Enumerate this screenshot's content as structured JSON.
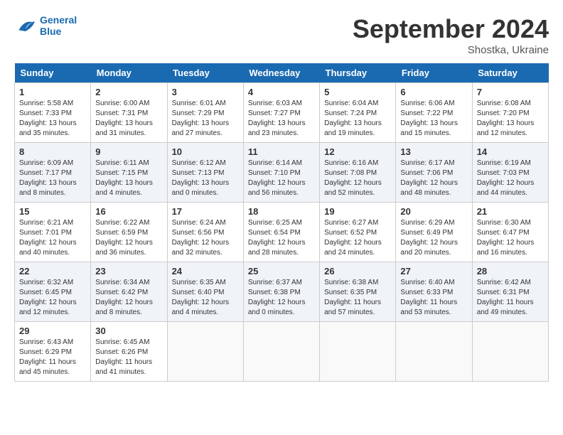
{
  "header": {
    "logo": {
      "line1": "General",
      "line2": "Blue"
    },
    "title": "September 2024",
    "subtitle": "Shostka, Ukraine"
  },
  "weekdays": [
    "Sunday",
    "Monday",
    "Tuesday",
    "Wednesday",
    "Thursday",
    "Friday",
    "Saturday"
  ],
  "weeks": [
    [
      {
        "day": "1",
        "sunrise": "Sunrise: 5:58 AM",
        "sunset": "Sunset: 7:33 PM",
        "daylight": "Daylight: 13 hours and 35 minutes."
      },
      {
        "day": "2",
        "sunrise": "Sunrise: 6:00 AM",
        "sunset": "Sunset: 7:31 PM",
        "daylight": "Daylight: 13 hours and 31 minutes."
      },
      {
        "day": "3",
        "sunrise": "Sunrise: 6:01 AM",
        "sunset": "Sunset: 7:29 PM",
        "daylight": "Daylight: 13 hours and 27 minutes."
      },
      {
        "day": "4",
        "sunrise": "Sunrise: 6:03 AM",
        "sunset": "Sunset: 7:27 PM",
        "daylight": "Daylight: 13 hours and 23 minutes."
      },
      {
        "day": "5",
        "sunrise": "Sunrise: 6:04 AM",
        "sunset": "Sunset: 7:24 PM",
        "daylight": "Daylight: 13 hours and 19 minutes."
      },
      {
        "day": "6",
        "sunrise": "Sunrise: 6:06 AM",
        "sunset": "Sunset: 7:22 PM",
        "daylight": "Daylight: 13 hours and 15 minutes."
      },
      {
        "day": "7",
        "sunrise": "Sunrise: 6:08 AM",
        "sunset": "Sunset: 7:20 PM",
        "daylight": "Daylight: 13 hours and 12 minutes."
      }
    ],
    [
      {
        "day": "8",
        "sunrise": "Sunrise: 6:09 AM",
        "sunset": "Sunset: 7:17 PM",
        "daylight": "Daylight: 13 hours and 8 minutes."
      },
      {
        "day": "9",
        "sunrise": "Sunrise: 6:11 AM",
        "sunset": "Sunset: 7:15 PM",
        "daylight": "Daylight: 13 hours and 4 minutes."
      },
      {
        "day": "10",
        "sunrise": "Sunrise: 6:12 AM",
        "sunset": "Sunset: 7:13 PM",
        "daylight": "Daylight: 13 hours and 0 minutes."
      },
      {
        "day": "11",
        "sunrise": "Sunrise: 6:14 AM",
        "sunset": "Sunset: 7:10 PM",
        "daylight": "Daylight: 12 hours and 56 minutes."
      },
      {
        "day": "12",
        "sunrise": "Sunrise: 6:16 AM",
        "sunset": "Sunset: 7:08 PM",
        "daylight": "Daylight: 12 hours and 52 minutes."
      },
      {
        "day": "13",
        "sunrise": "Sunrise: 6:17 AM",
        "sunset": "Sunset: 7:06 PM",
        "daylight": "Daylight: 12 hours and 48 minutes."
      },
      {
        "day": "14",
        "sunrise": "Sunrise: 6:19 AM",
        "sunset": "Sunset: 7:03 PM",
        "daylight": "Daylight: 12 hours and 44 minutes."
      }
    ],
    [
      {
        "day": "15",
        "sunrise": "Sunrise: 6:21 AM",
        "sunset": "Sunset: 7:01 PM",
        "daylight": "Daylight: 12 hours and 40 minutes."
      },
      {
        "day": "16",
        "sunrise": "Sunrise: 6:22 AM",
        "sunset": "Sunset: 6:59 PM",
        "daylight": "Daylight: 12 hours and 36 minutes."
      },
      {
        "day": "17",
        "sunrise": "Sunrise: 6:24 AM",
        "sunset": "Sunset: 6:56 PM",
        "daylight": "Daylight: 12 hours and 32 minutes."
      },
      {
        "day": "18",
        "sunrise": "Sunrise: 6:25 AM",
        "sunset": "Sunset: 6:54 PM",
        "daylight": "Daylight: 12 hours and 28 minutes."
      },
      {
        "day": "19",
        "sunrise": "Sunrise: 6:27 AM",
        "sunset": "Sunset: 6:52 PM",
        "daylight": "Daylight: 12 hours and 24 minutes."
      },
      {
        "day": "20",
        "sunrise": "Sunrise: 6:29 AM",
        "sunset": "Sunset: 6:49 PM",
        "daylight": "Daylight: 12 hours and 20 minutes."
      },
      {
        "day": "21",
        "sunrise": "Sunrise: 6:30 AM",
        "sunset": "Sunset: 6:47 PM",
        "daylight": "Daylight: 12 hours and 16 minutes."
      }
    ],
    [
      {
        "day": "22",
        "sunrise": "Sunrise: 6:32 AM",
        "sunset": "Sunset: 6:45 PM",
        "daylight": "Daylight: 12 hours and 12 minutes."
      },
      {
        "day": "23",
        "sunrise": "Sunrise: 6:34 AM",
        "sunset": "Sunset: 6:42 PM",
        "daylight": "Daylight: 12 hours and 8 minutes."
      },
      {
        "day": "24",
        "sunrise": "Sunrise: 6:35 AM",
        "sunset": "Sunset: 6:40 PM",
        "daylight": "Daylight: 12 hours and 4 minutes."
      },
      {
        "day": "25",
        "sunrise": "Sunrise: 6:37 AM",
        "sunset": "Sunset: 6:38 PM",
        "daylight": "Daylight: 12 hours and 0 minutes."
      },
      {
        "day": "26",
        "sunrise": "Sunrise: 6:38 AM",
        "sunset": "Sunset: 6:35 PM",
        "daylight": "Daylight: 11 hours and 57 minutes."
      },
      {
        "day": "27",
        "sunrise": "Sunrise: 6:40 AM",
        "sunset": "Sunset: 6:33 PM",
        "daylight": "Daylight: 11 hours and 53 minutes."
      },
      {
        "day": "28",
        "sunrise": "Sunrise: 6:42 AM",
        "sunset": "Sunset: 6:31 PM",
        "daylight": "Daylight: 11 hours and 49 minutes."
      }
    ],
    [
      {
        "day": "29",
        "sunrise": "Sunrise: 6:43 AM",
        "sunset": "Sunset: 6:29 PM",
        "daylight": "Daylight: 11 hours and 45 minutes."
      },
      {
        "day": "30",
        "sunrise": "Sunrise: 6:45 AM",
        "sunset": "Sunset: 6:26 PM",
        "daylight": "Daylight: 11 hours and 41 minutes."
      },
      null,
      null,
      null,
      null,
      null
    ]
  ]
}
